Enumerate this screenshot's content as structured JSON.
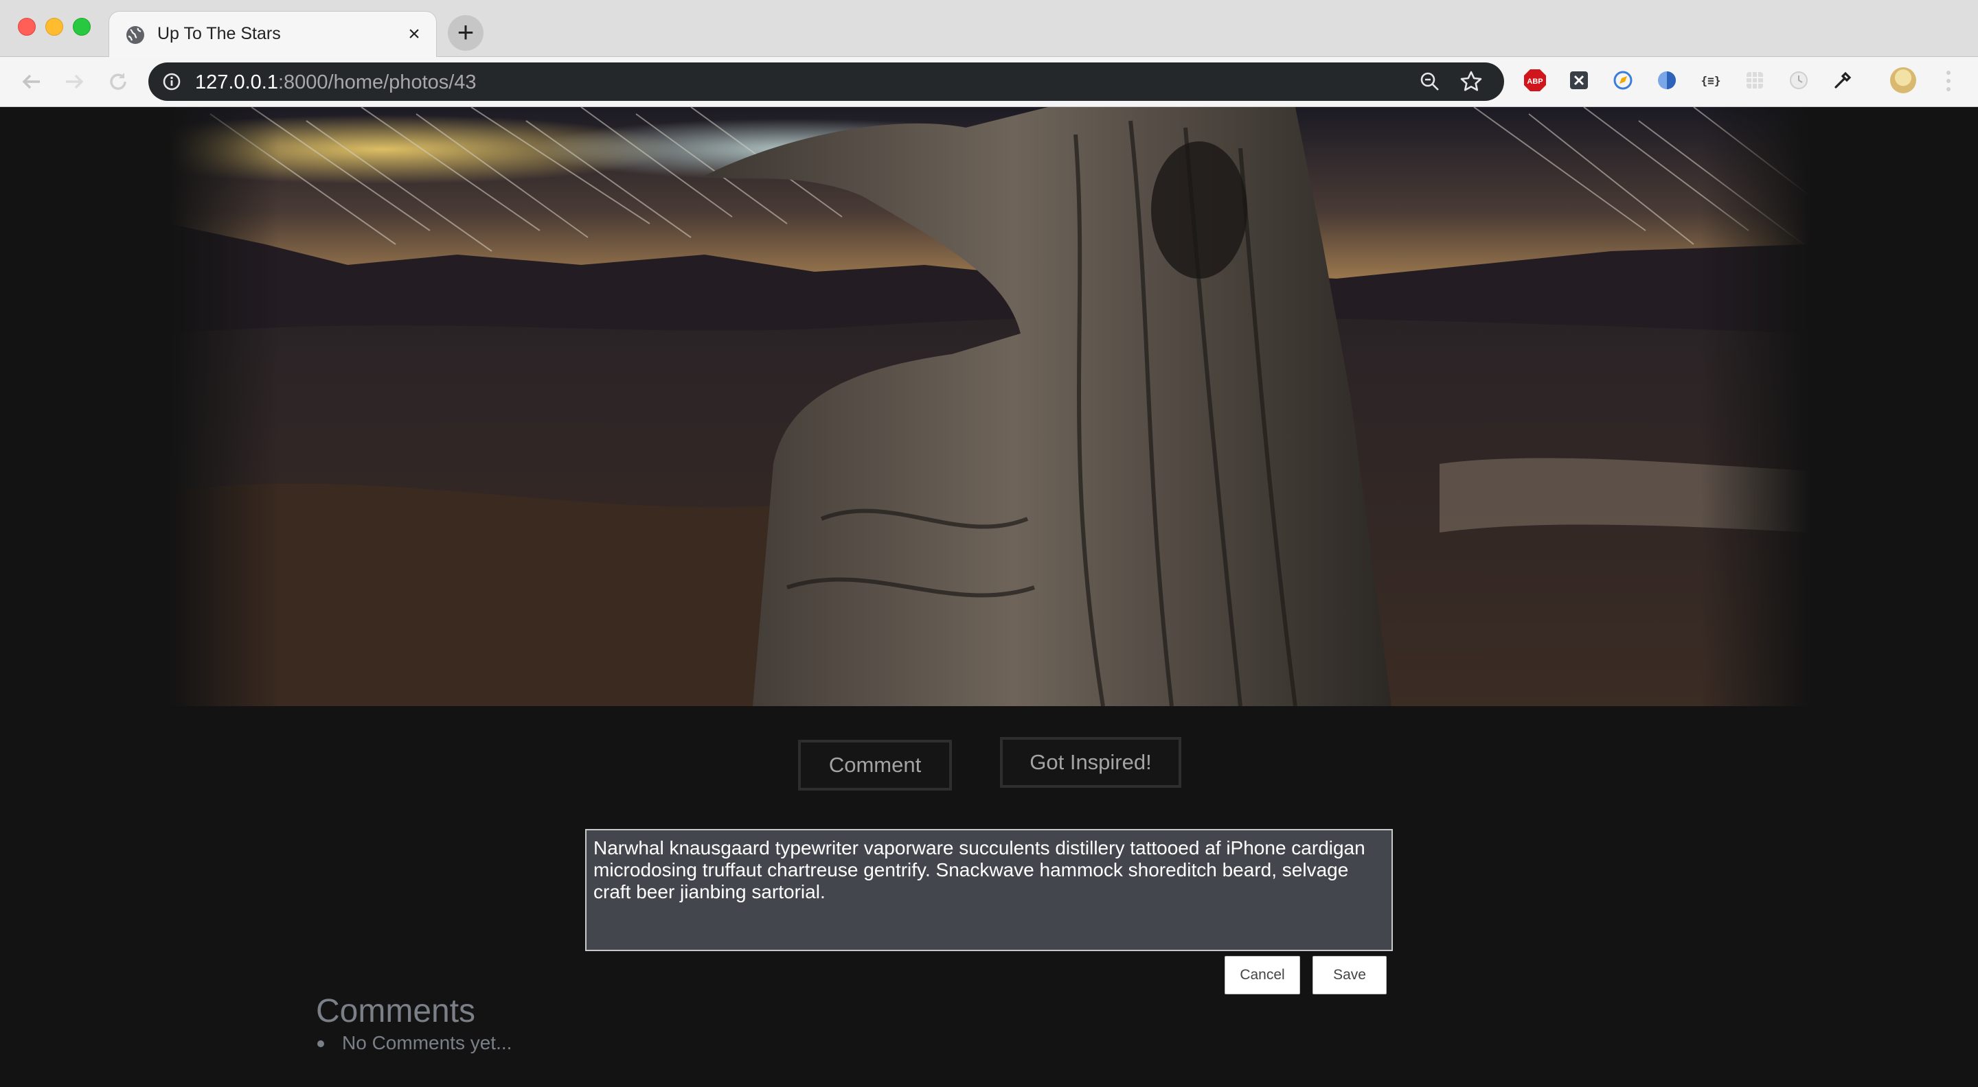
{
  "browser": {
    "tab_title": "Up To The Stars",
    "tab_close": "×",
    "new_tab": "+",
    "url_host": "127.0.0.1",
    "url_rest": ":8000/home/photos/43",
    "extensions": [
      "adblock-plus-icon",
      "x-extension-icon",
      "compass-extension-icon",
      "half-circle-extension-icon",
      "json-viewer-icon",
      "grid-extension-icon",
      "clock-extension-icon",
      "eyedropper-icon"
    ],
    "abp_label": "ABP",
    "json_label": "{≡}"
  },
  "photo": {
    "alt": "Star trails above a dark valley with a weathered tree stump in the foreground"
  },
  "actions": {
    "comment_label": "Comment",
    "inspired_label": "Got Inspired!"
  },
  "comment_form": {
    "text": "Narwhal knausgaard typewriter vaporware succulents distillery tattooed af iPhone cardigan microdosing truffaut chartreuse gentrify. Snackwave hammock shoreditch beard, selvage craft beer jianbing sartorial.",
    "cancel_label": "Cancel",
    "save_label": "Save"
  },
  "comments": {
    "heading": "Comments",
    "items": [
      "No Comments yet..."
    ]
  }
}
